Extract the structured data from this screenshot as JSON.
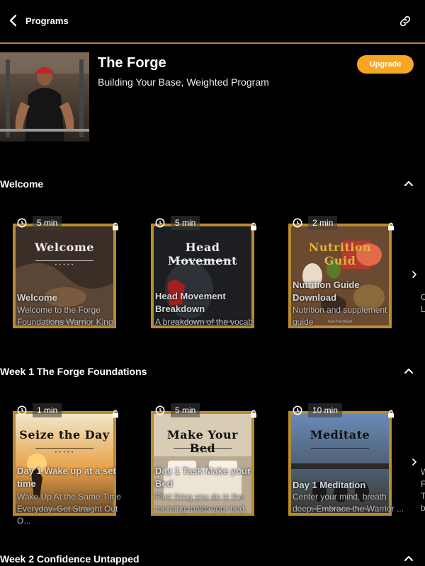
{
  "nav": {
    "back_label": "Programs"
  },
  "program": {
    "title": "The Forge",
    "subtitle": "Building Your Base, Weighted Program",
    "upgrade_label": "Upgrade"
  },
  "colors": {
    "accent": "#b98a2e",
    "upgrade": "#f5a623",
    "background": "#000000"
  },
  "sections": [
    {
      "title": "Welcome",
      "cards": [
        {
          "duration": "5 min",
          "art_word": "Welcome",
          "art_caption": "To The Forge Foundations",
          "title": "Welcome",
          "desc": "Welcome to the Forge Foundations Warrior King"
        },
        {
          "duration": "5 min",
          "art_word": "Head Movement",
          "art_caption": "How To Avoid A Punch And Why Basic",
          "title": "Head Movement Breakdown",
          "desc": "A breakdown of the vocab"
        },
        {
          "duration": "2 min",
          "art_word": "Nutrition Guid",
          "art_caption": "Fuel The Beast",
          "title": "Nutrition Guide Download",
          "desc": "Nutrition and supplement guide"
        }
      ],
      "peek": [
        "C",
        "L"
      ]
    },
    {
      "title": "Week 1 The Forge Foundations",
      "cards": [
        {
          "duration": "1 min",
          "art_word": "Seize the Day",
          "art_caption": "Commit To Day Time Set It and Wake Up",
          "title": "Day 1 Wake up at a set time",
          "desc": "Wake Up At the Same Time Everyday. Get Straight Out O..."
        },
        {
          "duration": "5 min",
          "art_word": "Make Your Bed",
          "art_caption": "The First Task Of The Day",
          "title": "Day 1 Task Make your Bed",
          "desc": "First thing you do in the morning make your bed."
        },
        {
          "duration": "10 min",
          "art_word": "Meditate",
          "art_caption": "Notice Yourself Mindspread Your Day",
          "title": "Day 1 Meditation",
          "desc": "Center your mind, breath deep. Embrace the Warrior ..."
        }
      ],
      "peek": [
        "W",
        "F",
        "T",
        "b"
      ]
    },
    {
      "title": "Week 2 Confidence Untapped"
    }
  ]
}
